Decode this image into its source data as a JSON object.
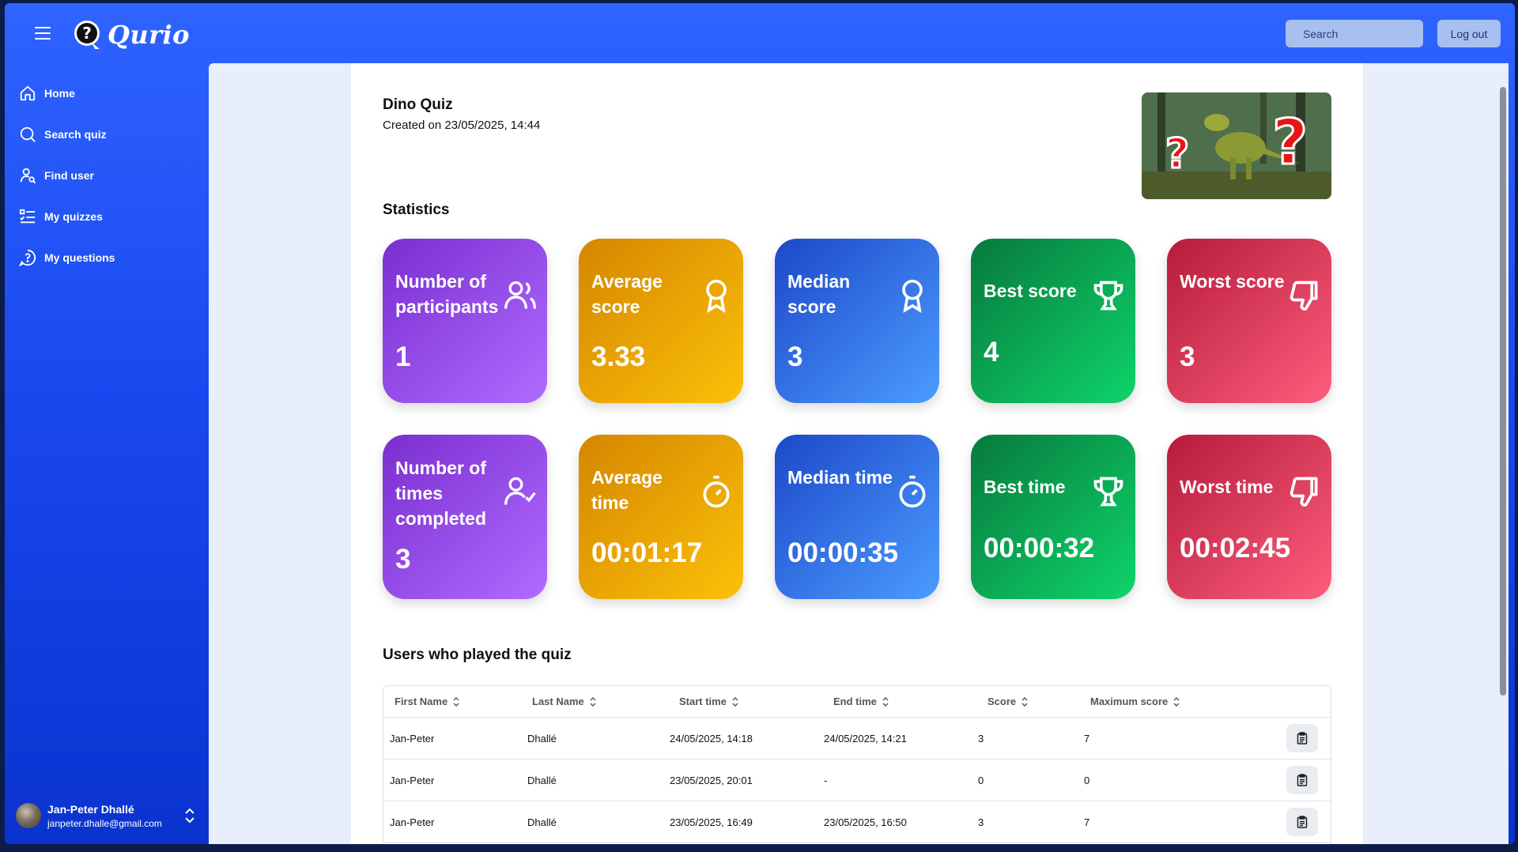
{
  "app": {
    "name": "Qurio"
  },
  "header": {
    "search_placeholder": "Search",
    "logout_label": "Log out"
  },
  "sidebar": {
    "items": [
      {
        "label": "Home",
        "icon": "home-icon"
      },
      {
        "label": "Search quiz",
        "icon": "search-icon"
      },
      {
        "label": "Find user",
        "icon": "user-search-icon"
      },
      {
        "label": "My quizzes",
        "icon": "list-icon"
      },
      {
        "label": "My questions",
        "icon": "question-circle-icon"
      }
    ],
    "user": {
      "name": "Jan-Peter Dhallé",
      "email": "janpeter.dhalle@gmail.com"
    }
  },
  "quiz": {
    "title": "Dino Quiz",
    "created": "Created on 23/05/2025, 14:44"
  },
  "statistics": {
    "title": "Statistics",
    "cards": [
      {
        "label": "Number of participants",
        "value": "1",
        "icon": "users-icon",
        "color": "#8a3ee0"
      },
      {
        "label": "Average score",
        "value": "3.33",
        "icon": "award-icon",
        "color": "#e89e00"
      },
      {
        "label": "Median score",
        "value": "3",
        "icon": "award-icon",
        "color": "#2d6ae0"
      },
      {
        "label": "Best score",
        "value": "4",
        "icon": "trophy-icon",
        "color": "#0a9a4c"
      },
      {
        "label": "Worst score",
        "value": "3",
        "icon": "thumbs-down-icon",
        "color": "#d63358"
      },
      {
        "label": "Number of times completed",
        "value": "3",
        "icon": "user-check-icon",
        "color": "#8a3ee0"
      },
      {
        "label": "Average time",
        "value": "00:01:17",
        "icon": "timer-icon",
        "color": "#e89e00"
      },
      {
        "label": "Median time",
        "value": "00:00:35",
        "icon": "timer-icon",
        "color": "#2d6ae0"
      },
      {
        "label": "Best time",
        "value": "00:00:32",
        "icon": "trophy-icon",
        "color": "#0a9a4c"
      },
      {
        "label": "Worst time",
        "value": "00:02:45",
        "icon": "thumbs-down-icon",
        "color": "#d63358"
      }
    ]
  },
  "players": {
    "title": "Users who played the quiz",
    "columns": [
      "First Name",
      "Last Name",
      "Start time",
      "End time",
      "Score",
      "Maximum score"
    ],
    "rows": [
      [
        "Jan-Peter",
        "Dhallé",
        "24/05/2025, 14:18",
        "24/05/2025, 14:21",
        "3",
        "7"
      ],
      [
        "Jan-Peter",
        "Dhallé",
        "23/05/2025, 20:01",
        "-",
        "0",
        "0"
      ],
      [
        "Jan-Peter",
        "Dhallé",
        "23/05/2025, 16:49",
        "23/05/2025, 16:50",
        "3",
        "7"
      ]
    ]
  }
}
